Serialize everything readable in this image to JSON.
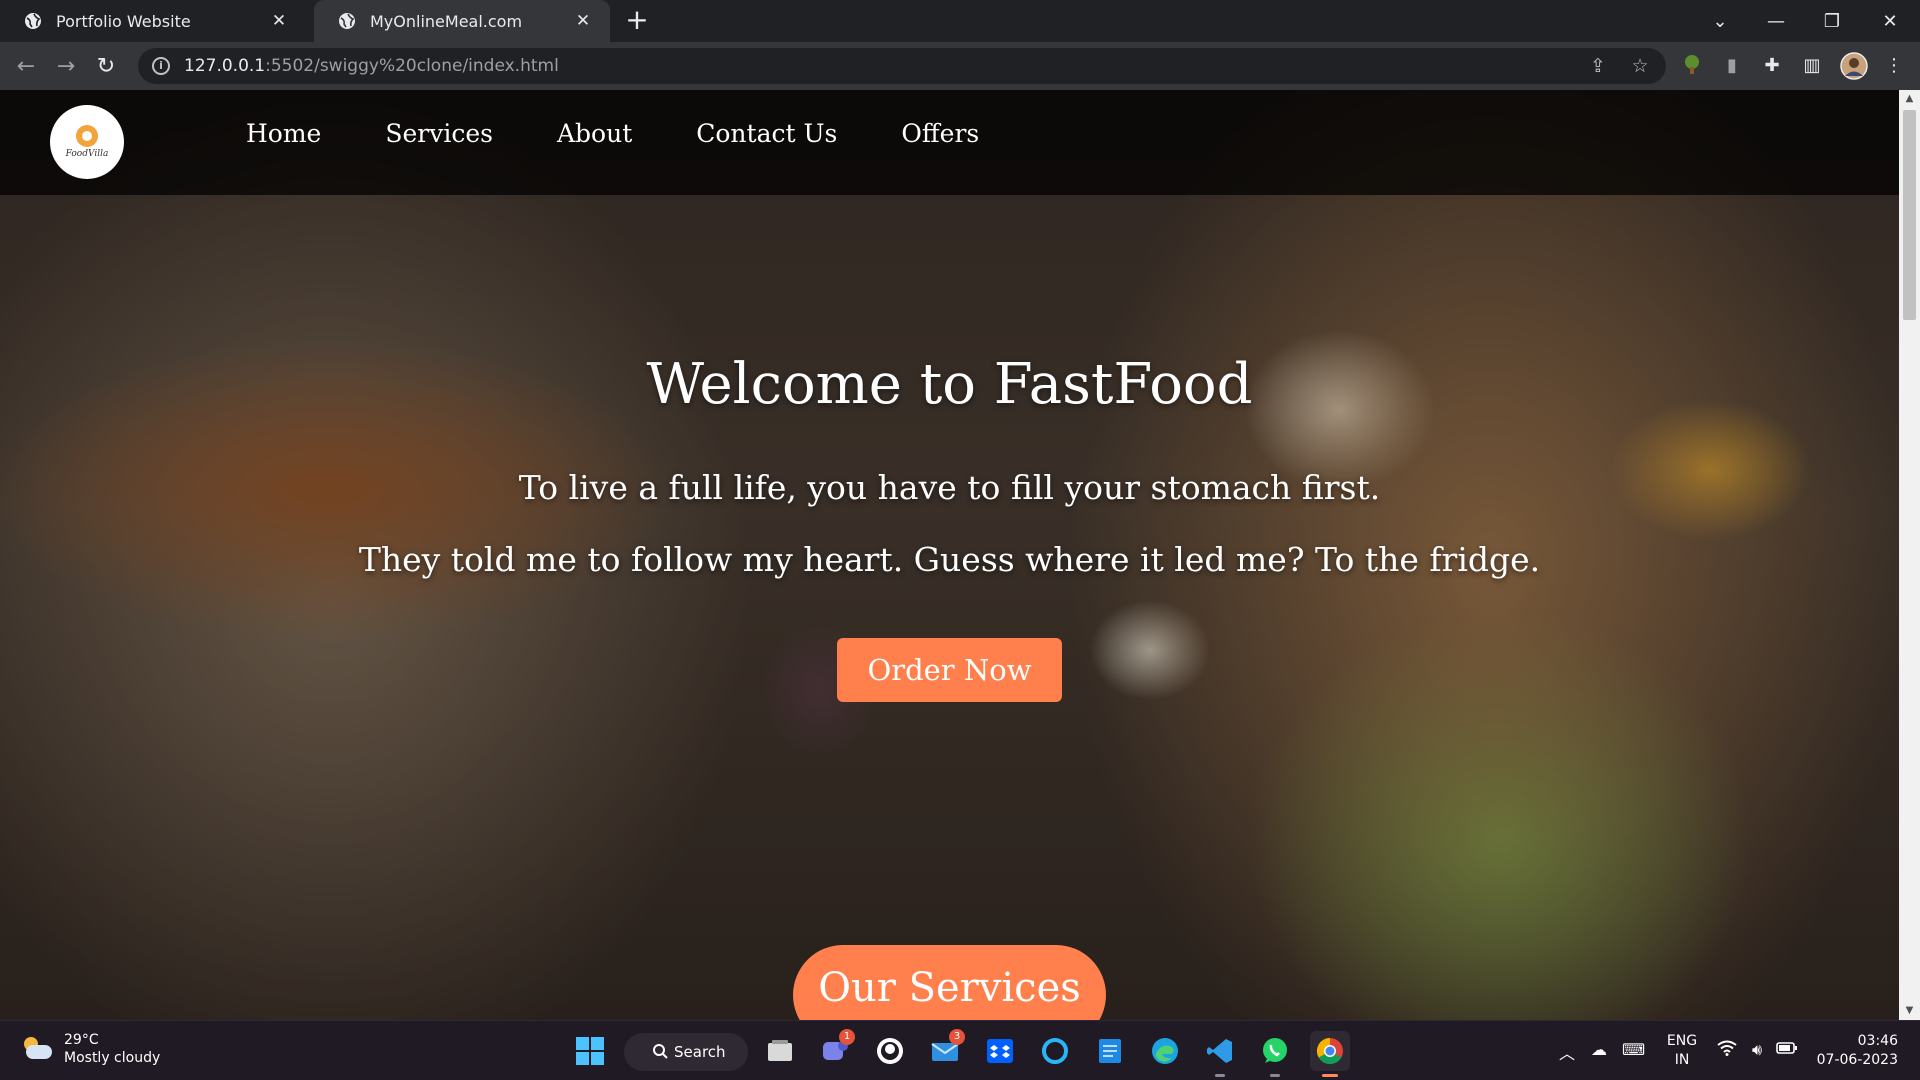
{
  "browser": {
    "tabs": [
      {
        "title": "Portfolio Website",
        "active": false
      },
      {
        "title": "MyOnlineMeal.com",
        "active": true
      }
    ],
    "url_host": "127.0.0.1",
    "url_path": ":5502/swiggy%20clone/index.html"
  },
  "site": {
    "logo_text": "FoodVilla",
    "nav": [
      "Home",
      "Services",
      "About",
      "Contact Us",
      "Offers"
    ],
    "hero_title": "Welcome to FastFood",
    "hero_line1": "To live a full life, you have to fill your stomach first.",
    "hero_line2": "They told me to follow my heart. Guess where it led me? To the fridge.",
    "order_button": "Order Now",
    "section_heading": "Our Services"
  },
  "taskbar": {
    "weather_temp": "29°C",
    "weather_condition": "Mostly cloudy",
    "search_label": "Search",
    "teams_badge": "1",
    "mail_badge": "3",
    "language_line1": "ENG",
    "language_line2": "IN",
    "time": "03:46",
    "date": "07-06-2023"
  },
  "colors": {
    "accent_orange": "#ff7f4d",
    "browser_dark": "#202124",
    "browser_toolbar": "#35363a"
  }
}
